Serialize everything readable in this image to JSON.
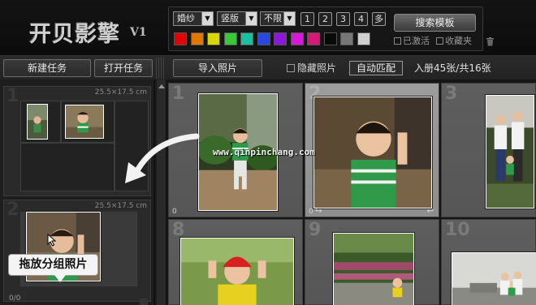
{
  "header": {
    "logo": "开贝影擎",
    "logo_version": "V1",
    "filters": {
      "style": "婚纱",
      "orientation": "竖版",
      "limit": "不限",
      "counts": [
        "1",
        "2",
        "3",
        "4",
        "多"
      ]
    },
    "swatch_colors": [
      "#e00000",
      "#e07800",
      "#d8d800",
      "#38c838",
      "#18c0a0",
      "#2848e0",
      "#8a18d8",
      "#d818d8",
      "#d81878",
      "#0a0a0a",
      "#777777",
      "#d0d0d0"
    ],
    "search_button": "搜索模板",
    "checkbox_activated": "已激活",
    "checkbox_favorites": "收藏夹"
  },
  "toolbar": {
    "new_task": "新建任务",
    "open_task": "打开任务",
    "import_photos": "导入照片",
    "hide_photos": "隐藏照片",
    "auto_match": "自动匹配",
    "stats": "入册45张/共16张"
  },
  "left_panel": {
    "groups": [
      {
        "number": "1",
        "size": "25.5×17.5 cm"
      },
      {
        "number": "2",
        "size": "25.5×17.5 cm"
      }
    ],
    "drag_tip": "拖放分组照片",
    "bottom_counter": "0/0"
  },
  "grid": {
    "tiles": [
      {
        "number": "1",
        "count": "0"
      },
      {
        "number": "2",
        "count": "0"
      },
      {
        "number": "3",
        "count": ""
      },
      {
        "number": "8",
        "count": ""
      },
      {
        "number": "9",
        "count": ""
      },
      {
        "number": "10",
        "count": ""
      }
    ],
    "watermark": "www.qinpinchang.com"
  }
}
